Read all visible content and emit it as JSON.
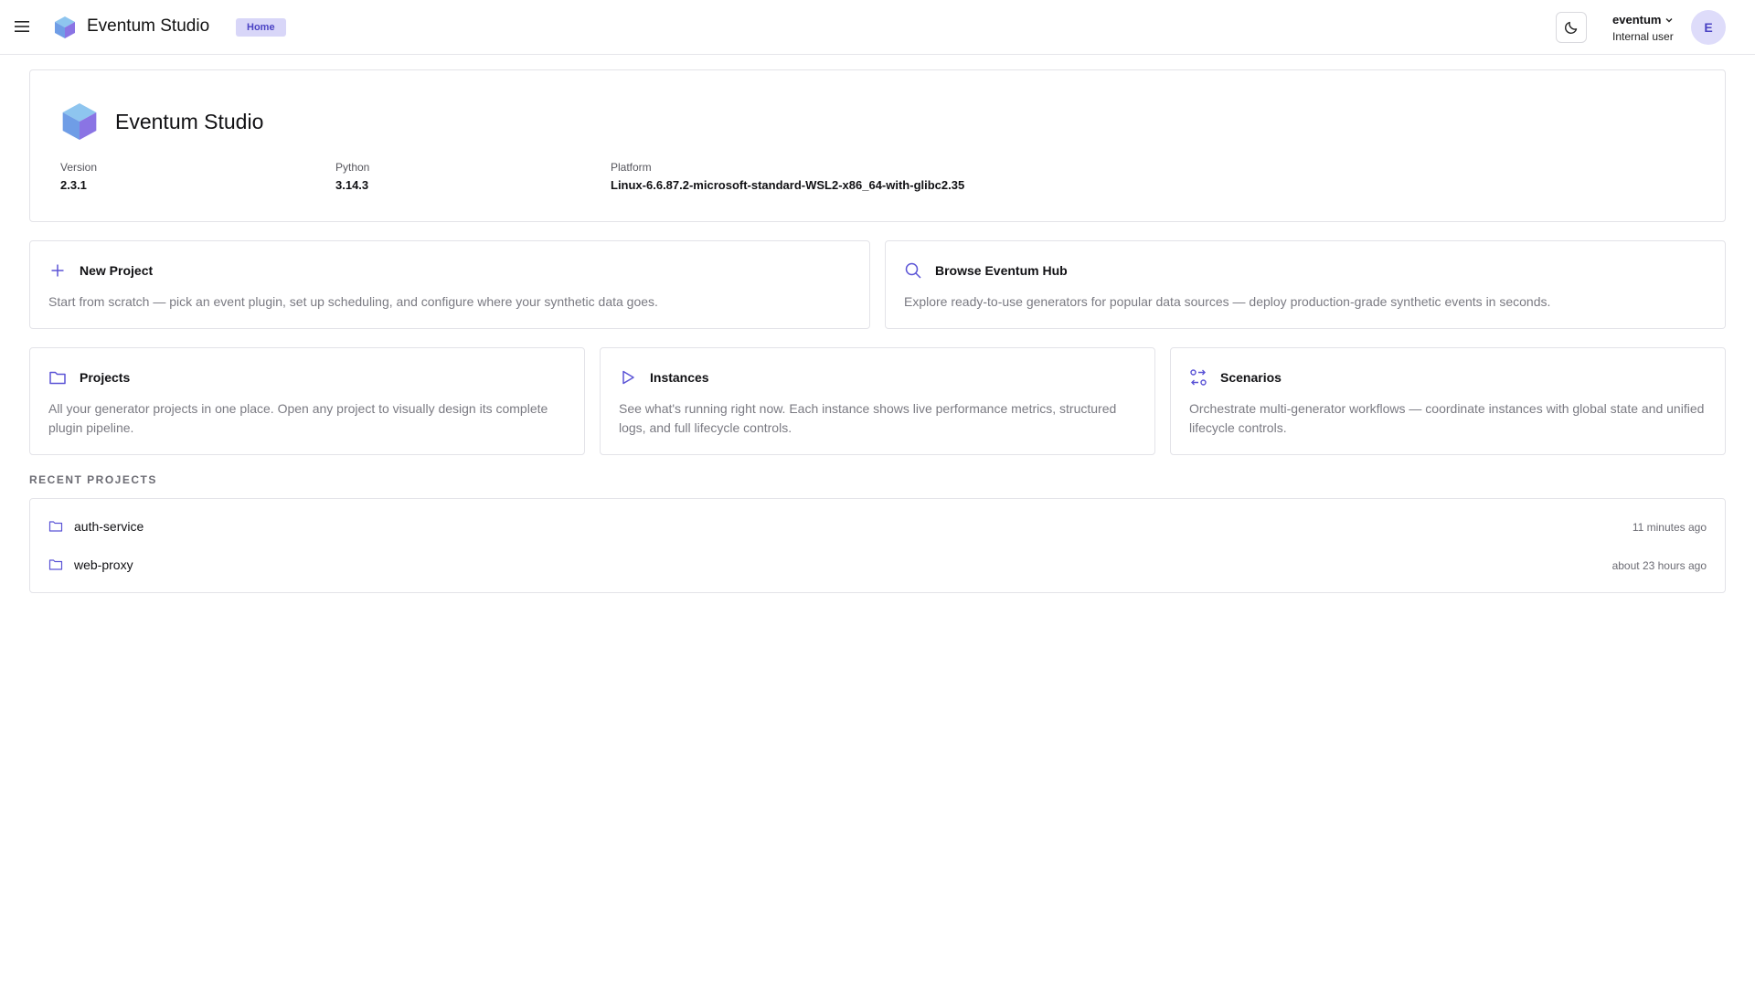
{
  "header": {
    "app_title": "Eventum Studio",
    "breadcrumb": "Home",
    "user": {
      "name": "eventum",
      "role": "Internal user",
      "initial": "E"
    }
  },
  "info": {
    "title": "Eventum Studio",
    "version": {
      "label": "Version",
      "value": "2.3.1"
    },
    "python": {
      "label": "Python",
      "value": "3.14.3"
    },
    "platform": {
      "label": "Platform",
      "value": "Linux-6.6.87.2-microsoft-standard-WSL2-x86_64-with-glibc2.35"
    }
  },
  "actions": {
    "new_project": {
      "title": "New Project",
      "description": "Start from scratch — pick an event plugin, set up scheduling, and configure where your synthetic data goes."
    },
    "browse_hub": {
      "title": "Browse Eventum Hub",
      "description": "Explore ready-to-use generators for popular data sources — deploy production-grade synthetic events in seconds."
    },
    "projects": {
      "title": "Projects",
      "description": "All your generator projects in one place. Open any project to visually design its complete plugin pipeline."
    },
    "instances": {
      "title": "Instances",
      "description": "See what's running right now. Each instance shows live performance metrics, structured logs, and full lifecycle controls."
    },
    "scenarios": {
      "title": "Scenarios",
      "description": "Orchestrate multi-generator workflows — coordinate instances with global state and unified lifecycle controls."
    }
  },
  "recent": {
    "label": "RECENT PROJECTS",
    "items": [
      {
        "name": "auth-service",
        "time": "11 minutes ago"
      },
      {
        "name": "web-proxy",
        "time": "about 23 hours ago"
      }
    ]
  },
  "colors": {
    "accent": "#5b54d6",
    "badge_bg": "#d8d6f8",
    "border": "#e3e3e8",
    "muted_text": "#7a7a82"
  },
  "icons": {
    "menu": "hamburger-menu-icon",
    "logo": "cube-logo-icon",
    "theme": "moon-icon",
    "chevron": "chevron-down-icon",
    "new_project": "plus-icon",
    "browse_hub": "search-icon",
    "projects": "folder-icon",
    "instances": "play-icon",
    "scenarios": "workflow-icon"
  }
}
